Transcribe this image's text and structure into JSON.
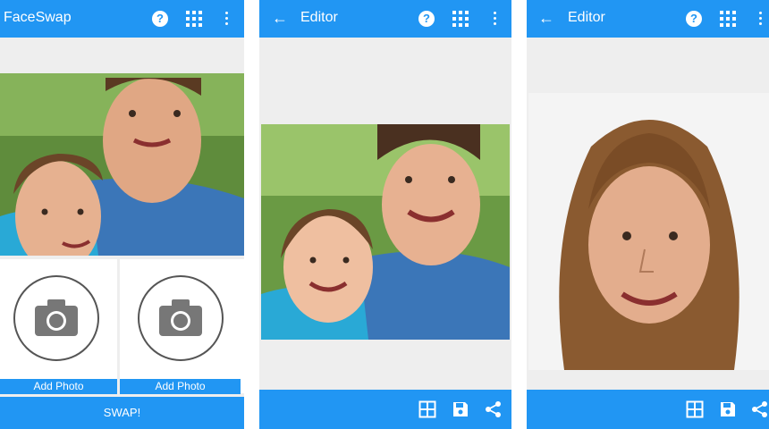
{
  "screen1": {
    "title": "FaceSwap",
    "slots": [
      {
        "label": "Add Photo",
        "icon": "camera-icon"
      },
      {
        "label": "Add Photo",
        "icon": "camera-icon"
      }
    ],
    "swap_label": "SWAP!"
  },
  "screen2": {
    "title": "Editor"
  },
  "screen3": {
    "title": "Editor"
  },
  "icons": {
    "help": "?",
    "back": "←",
    "grid": "grid-icon",
    "menu": "more-vert-icon",
    "layout": "layout-grid-icon",
    "save": "save-icon",
    "share": "share-icon"
  },
  "colors": {
    "primary": "#2196f3",
    "background": "#eeeeee"
  }
}
